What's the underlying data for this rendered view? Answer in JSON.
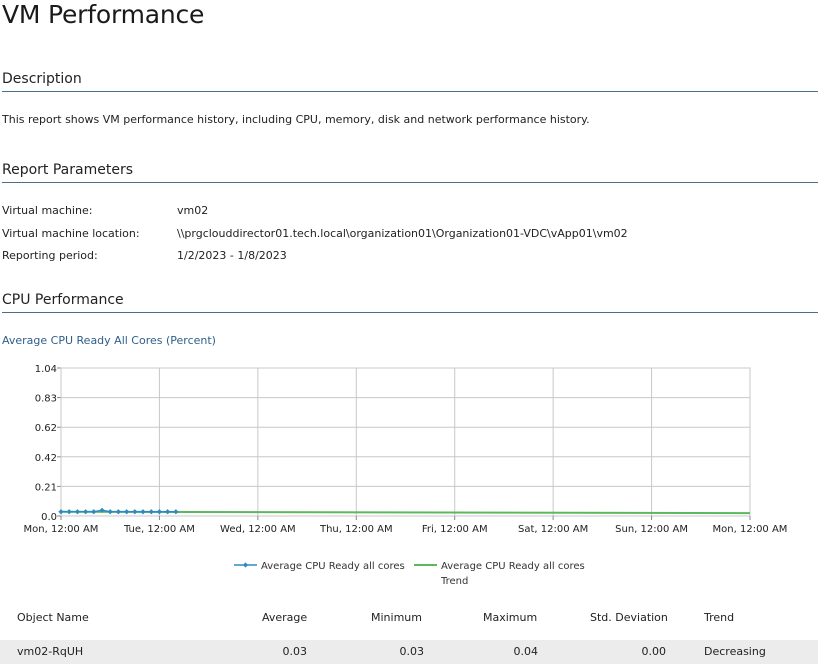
{
  "page_title": "VM Performance",
  "description": {
    "heading": "Description",
    "text": "This report shows VM performance history, including CPU, memory, disk and network performance history."
  },
  "parameters": {
    "heading": "Report Parameters",
    "items": [
      {
        "label": "Virtual machine:",
        "value": "vm02"
      },
      {
        "label": "Virtual machine location:",
        "value": "\\\\prgclouddirector01.tech.local\\organization01\\Organization01-VDC\\vApp01\\vm02"
      },
      {
        "label": "Reporting period:",
        "value": "1/2/2023 - 1/8/2023"
      }
    ]
  },
  "cpu": {
    "heading": "CPU Performance",
    "chart_title": "Average CPU Ready All Cores (Percent)"
  },
  "chart_data": {
    "type": "line",
    "title": "Average CPU Ready All Cores (Percent)",
    "x_ticks": [
      "Mon, 12:00 AM",
      "Tue, 12:00 AM",
      "Wed, 12:00 AM",
      "Thu, 12:00 AM",
      "Fri, 12:00 AM",
      "Sat, 12:00 AM",
      "Sun, 12:00 AM",
      "Mon, 12:00 AM"
    ],
    "y_ticks": [
      "0.0",
      "0.21",
      "0.42",
      "0.62",
      "0.83",
      "1.04"
    ],
    "ylim": [
      0,
      1.04
    ],
    "xlim_days": [
      0,
      7
    ],
    "grid": true,
    "legend_position": "bottom",
    "series": [
      {
        "name": "Average CPU Ready all cores",
        "color": "#2e8bc0",
        "marker": "diamond",
        "x_days": [
          0,
          0.083,
          0.167,
          0.25,
          0.333,
          0.417,
          0.5,
          0.583,
          0.667,
          0.75,
          0.833,
          0.917,
          1.0,
          1.083,
          1.167
        ],
        "values": [
          0.03,
          0.03,
          0.03,
          0.03,
          0.03,
          0.04,
          0.03,
          0.03,
          0.03,
          0.03,
          0.03,
          0.03,
          0.03,
          0.03,
          0.03
        ]
      },
      {
        "name": "Average CPU Ready all cores\nTrend",
        "name_lines": [
          "Average CPU Ready all cores",
          "Trend"
        ],
        "color": "#5cb85c",
        "marker": "none",
        "x_days": [
          0,
          7
        ],
        "values": [
          0.03,
          0.02
        ]
      }
    ]
  },
  "table": {
    "headers": {
      "object_name": "Object Name",
      "average": "Average",
      "minimum": "Minimum",
      "maximum": "Maximum",
      "std_dev": "Std. Deviation",
      "trend": "Trend"
    },
    "rows": [
      {
        "object_name": "vm02-RqUH",
        "average": "0.03",
        "minimum": "0.03",
        "maximum": "0.04",
        "std_dev": "0.00",
        "trend": "Decreasing"
      }
    ]
  }
}
